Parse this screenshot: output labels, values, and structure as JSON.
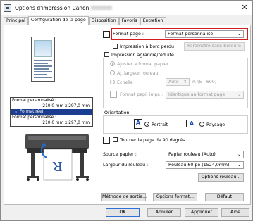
{
  "window": {
    "title": "Options d'impression Canon",
    "close_glyph": "✕"
  },
  "tabs": [
    "Principal",
    "Configuration de la page",
    "Disposition",
    "Favoris",
    "Entretien"
  ],
  "preview": {
    "line1": "Format personnalisé :",
    "line2": "210,0 mm x 297,0 mm",
    "mode_arrow": "↓",
    "mode": "Format réel",
    "line3": "Format personnalisé :",
    "line4": "210,0 mm x 297,0 mm"
  },
  "page_setup": {
    "format_label": "Format page :",
    "format_value": "Format personnalisé",
    "borderless_label": "Impression à bord perdu",
    "borderless_button": "Paramètre sans bordure",
    "enlarge_label": "Impression agrandie/réduite",
    "fit_paper": "Ajuster à format papier",
    "fit_roll": "Aj. largeur rouleau",
    "scale": "Échelle",
    "scale_value": "Auto",
    "scale_unit": "% (5 - 600)",
    "paper_format_label": "Format papi. impr. :",
    "paper_format_value": "Identique au format page"
  },
  "orientation": {
    "label": "Orientation",
    "portrait": "Portrait",
    "landscape": "Paysage",
    "rotate_label": "Tourner la page de 90 degrés"
  },
  "paper": {
    "source_label": "Source papier :",
    "source_value": "Papier rouleau (Auto)",
    "roll_width_label": "Largeur du rouleau :",
    "roll_width_value": "Rouleau 60 po (1524,0mm)",
    "roll_options_button": "Options rouleau..."
  },
  "bottom_buttons": {
    "output_method": "Méthode de sortie...",
    "format_options": "Options format...",
    "defaults": "Défaut"
  },
  "dialog_buttons": {
    "ok": "OK",
    "cancel": "Annuler",
    "apply": "Appliquer",
    "help": "Aide"
  },
  "colors": {
    "highlight": "#d21d1d",
    "mode_bar": "#1b3d8f"
  }
}
